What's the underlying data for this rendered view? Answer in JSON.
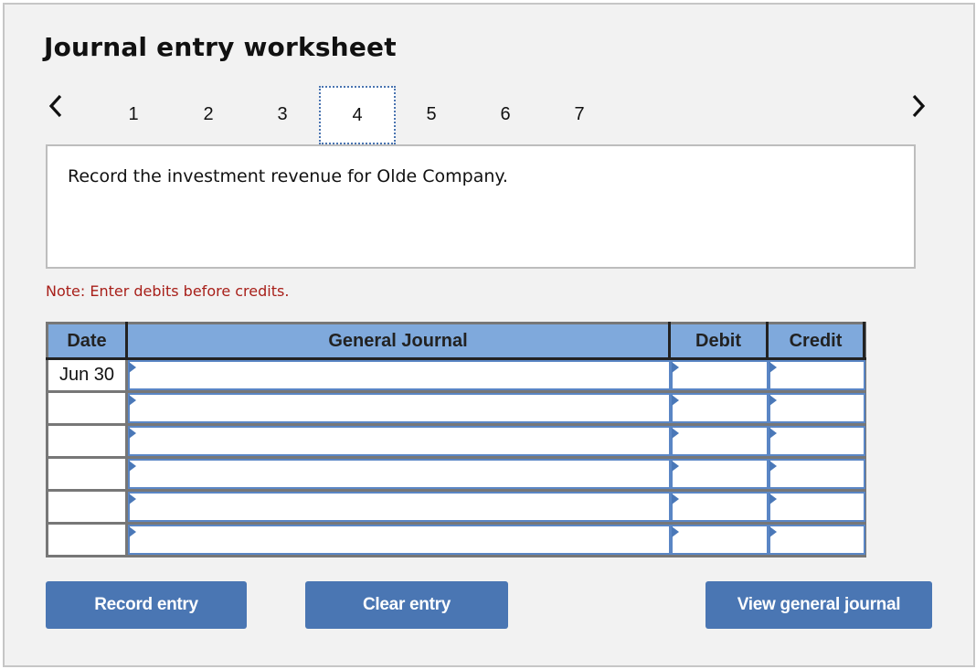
{
  "header": {
    "title": "Journal entry worksheet"
  },
  "navigation": {
    "prev_icon": "chevron-left-icon",
    "next_icon": "chevron-right-icon",
    "steps": [
      "1",
      "2",
      "3",
      "4",
      "5",
      "6",
      "7"
    ],
    "active_step": "4"
  },
  "question": {
    "text": "Record the investment revenue for Olde Company."
  },
  "note": {
    "text": "Note: Enter debits before credits."
  },
  "journal": {
    "columns": {
      "date": "Date",
      "general_journal": "General Journal",
      "debit": "Debit",
      "credit": "Credit"
    },
    "rows": [
      {
        "date": "Jun 30",
        "account": "",
        "debit": "",
        "credit": ""
      },
      {
        "date": "",
        "account": "",
        "debit": "",
        "credit": ""
      },
      {
        "date": "",
        "account": "",
        "debit": "",
        "credit": ""
      },
      {
        "date": "",
        "account": "",
        "debit": "",
        "credit": ""
      },
      {
        "date": "",
        "account": "",
        "debit": "",
        "credit": ""
      },
      {
        "date": "",
        "account": "",
        "debit": "",
        "credit": ""
      }
    ]
  },
  "buttons": {
    "record": "Record entry",
    "clear": "Clear entry",
    "view": "View general journal"
  },
  "colors": {
    "header_fill": "#7fa9dc",
    "button_fill": "#4a76b3",
    "input_border": "#5a86c5",
    "note_text": "#a8201a"
  }
}
